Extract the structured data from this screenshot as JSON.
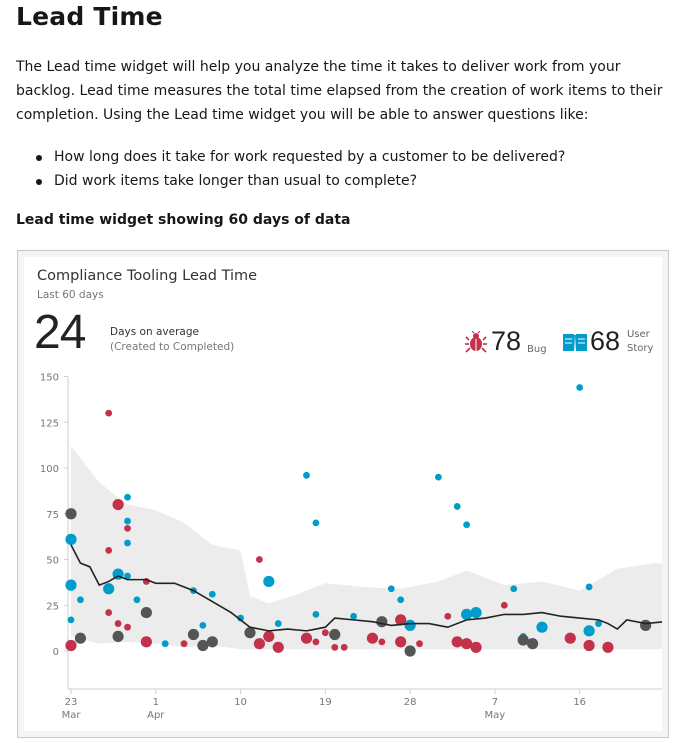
{
  "page": {
    "title": "Lead Time",
    "intro": "The Lead time widget will help you analyze the time it takes to deliver work from your backlog. Lead time measures the total time elapsed from the creation of work items to their completion. Using the Lead time widget you will be able to answer questions like:",
    "questions": [
      "How long does it take for work requested by a customer to be delivered?",
      "Did work items take longer than usual to complete?"
    ],
    "caption": "Lead time widget showing 60 days of data"
  },
  "widget": {
    "title": "Compliance Tooling Lead Time",
    "subtitle": "Last 60 days",
    "average_days": "24",
    "average_label": "Days on average",
    "average_sublabel": "(Created to Completed)",
    "bug_count": "78",
    "bug_label": "Bug",
    "bug_icon": "bug-icon",
    "story_count": "68",
    "story_label_1": "User",
    "story_label_2": "Story",
    "story_icon": "book-icon"
  },
  "colors": {
    "bug": "#c4314b",
    "story": "#009ccc",
    "multi": "#555555",
    "band": "#ececec",
    "trend": "#222222"
  },
  "chart_data": {
    "type": "scatter",
    "ylim": [
      0,
      150
    ],
    "yticks": [
      0,
      25,
      50,
      75,
      100,
      125,
      150
    ],
    "xlim": [
      0,
      68
    ],
    "xticks": [
      {
        "day": 0,
        "label": "23",
        "month": "Mar"
      },
      {
        "day": 9,
        "label": "1",
        "month": "Apr"
      },
      {
        "day": 18,
        "label": "10",
        "month": ""
      },
      {
        "day": 27,
        "label": "19",
        "month": ""
      },
      {
        "day": 36,
        "label": "28",
        "month": ""
      },
      {
        "day": 45,
        "label": "7",
        "month": "May"
      },
      {
        "day": 54,
        "label": "16",
        "month": ""
      }
    ],
    "series": [
      {
        "name": "Bug",
        "points": [
          [
            0,
            3,
            "l"
          ],
          [
            4,
            130,
            "s"
          ],
          [
            4,
            55,
            "s"
          ],
          [
            4,
            21,
            "s"
          ],
          [
            5,
            15,
            "s"
          ],
          [
            5,
            80,
            "l"
          ],
          [
            6,
            13,
            "s"
          ],
          [
            6,
            67,
            "s"
          ],
          [
            8,
            38,
            "s"
          ],
          [
            8,
            5,
            "l"
          ],
          [
            12,
            4,
            "s"
          ],
          [
            20,
            50,
            "s"
          ],
          [
            20,
            4,
            "l"
          ],
          [
            21,
            8,
            "l"
          ],
          [
            22,
            2,
            "l"
          ],
          [
            25,
            7,
            "l"
          ],
          [
            26,
            5,
            "s"
          ],
          [
            27,
            10,
            "s"
          ],
          [
            28,
            2,
            "s"
          ],
          [
            29,
            2,
            "s"
          ],
          [
            32,
            7,
            "l"
          ],
          [
            33,
            5,
            "s"
          ],
          [
            35,
            17,
            "l"
          ],
          [
            35,
            5,
            "l"
          ],
          [
            37,
            4,
            "s"
          ],
          [
            40,
            19,
            "s"
          ],
          [
            41,
            5,
            "l"
          ],
          [
            42,
            4,
            "l"
          ],
          [
            43,
            2,
            "l"
          ],
          [
            46,
            25,
            "s"
          ],
          [
            53,
            7,
            "l"
          ],
          [
            55,
            3,
            "l"
          ],
          [
            57,
            2,
            "l"
          ]
        ]
      },
      {
        "name": "User Story",
        "points": [
          [
            0,
            61,
            "l"
          ],
          [
            0,
            36,
            "l"
          ],
          [
            0,
            17,
            "s"
          ],
          [
            1,
            28,
            "s"
          ],
          [
            4,
            34,
            "l"
          ],
          [
            5,
            42,
            "l"
          ],
          [
            6,
            84,
            "s"
          ],
          [
            6,
            71,
            "s"
          ],
          [
            6,
            59,
            "s"
          ],
          [
            6,
            41,
            "s"
          ],
          [
            7,
            28,
            "s"
          ],
          [
            10,
            4,
            "s"
          ],
          [
            13,
            33,
            "s"
          ],
          [
            14,
            14,
            "s"
          ],
          [
            15,
            31,
            "s"
          ],
          [
            18,
            18,
            "s"
          ],
          [
            21,
            38,
            "l"
          ],
          [
            22,
            15,
            "s"
          ],
          [
            25,
            96,
            "s"
          ],
          [
            26,
            70,
            "s"
          ],
          [
            26,
            20,
            "s"
          ],
          [
            30,
            19,
            "s"
          ],
          [
            34,
            34,
            "s"
          ],
          [
            35,
            28,
            "s"
          ],
          [
            36,
            14,
            "l"
          ],
          [
            39,
            95,
            "s"
          ],
          [
            41,
            79,
            "s"
          ],
          [
            42,
            69,
            "s"
          ],
          [
            42,
            20,
            "l"
          ],
          [
            43,
            21,
            "l"
          ],
          [
            47,
            34,
            "s"
          ],
          [
            50,
            13,
            "l"
          ],
          [
            48,
            8,
            "s"
          ],
          [
            54,
            144,
            "s"
          ],
          [
            55,
            35,
            "s"
          ],
          [
            55,
            11,
            "l"
          ],
          [
            56,
            15,
            "s"
          ]
        ]
      },
      {
        "name": "Multiple",
        "points": [
          [
            0,
            75,
            "l"
          ],
          [
            1,
            7,
            "l"
          ],
          [
            5,
            8,
            "l"
          ],
          [
            8,
            21,
            "l"
          ],
          [
            13,
            9,
            "l"
          ],
          [
            14,
            3,
            "l"
          ],
          [
            15,
            5,
            "l"
          ],
          [
            19,
            10,
            "l"
          ],
          [
            28,
            9,
            "l"
          ],
          [
            33,
            16,
            "l"
          ],
          [
            36,
            0,
            "l"
          ],
          [
            48,
            6,
            "l"
          ],
          [
            49,
            4,
            "l"
          ],
          [
            61,
            14,
            "l"
          ]
        ]
      }
    ],
    "trend": [
      [
        0,
        58
      ],
      [
        1,
        48
      ],
      [
        2,
        46
      ],
      [
        3,
        36
      ],
      [
        4,
        38
      ],
      [
        5,
        41
      ],
      [
        6,
        39
      ],
      [
        7,
        39
      ],
      [
        8,
        39
      ],
      [
        9,
        37
      ],
      [
        11,
        37
      ],
      [
        13,
        33
      ],
      [
        15,
        27
      ],
      [
        17,
        21
      ],
      [
        19,
        13
      ],
      [
        21,
        11
      ],
      [
        23,
        12
      ],
      [
        25,
        11
      ],
      [
        26,
        12
      ],
      [
        27,
        13
      ],
      [
        28,
        18
      ],
      [
        30,
        17
      ],
      [
        32,
        16
      ],
      [
        34,
        14
      ],
      [
        36,
        15
      ],
      [
        38,
        15
      ],
      [
        40,
        13
      ],
      [
        42,
        17
      ],
      [
        44,
        18
      ],
      [
        46,
        20
      ],
      [
        48,
        20
      ],
      [
        50,
        21
      ],
      [
        52,
        19
      ],
      [
        54,
        18
      ],
      [
        56,
        17
      ],
      [
        57,
        15
      ],
      [
        58,
        12
      ],
      [
        59,
        17
      ],
      [
        61,
        15
      ],
      [
        63,
        16
      ],
      [
        65,
        15
      ],
      [
        67,
        16
      ]
    ],
    "band_upper": [
      [
        0,
        112
      ],
      [
        3,
        92
      ],
      [
        6,
        80
      ],
      [
        9,
        77
      ],
      [
        12,
        70
      ],
      [
        15,
        58
      ],
      [
        18,
        55
      ],
      [
        19,
        30
      ],
      [
        21,
        26
      ],
      [
        24,
        31
      ],
      [
        27,
        37
      ],
      [
        31,
        35
      ],
      [
        35,
        34
      ],
      [
        39,
        38
      ],
      [
        42,
        44
      ],
      [
        46,
        36
      ],
      [
        50,
        38
      ],
      [
        54,
        33
      ],
      [
        58,
        45
      ],
      [
        62,
        48
      ],
      [
        65,
        46
      ],
      [
        67,
        48
      ]
    ],
    "band_lower": [
      [
        0,
        8
      ],
      [
        3,
        4
      ],
      [
        6,
        5
      ],
      [
        9,
        4
      ],
      [
        12,
        2
      ],
      [
        15,
        3
      ],
      [
        18,
        1
      ],
      [
        21,
        1
      ],
      [
        24,
        1
      ],
      [
        27,
        1
      ],
      [
        31,
        1
      ],
      [
        35,
        1
      ],
      [
        39,
        1
      ],
      [
        42,
        1
      ],
      [
        46,
        1
      ],
      [
        50,
        1
      ],
      [
        54,
        1
      ],
      [
        58,
        1
      ],
      [
        62,
        1
      ],
      [
        65,
        2
      ],
      [
        67,
        2
      ]
    ]
  }
}
